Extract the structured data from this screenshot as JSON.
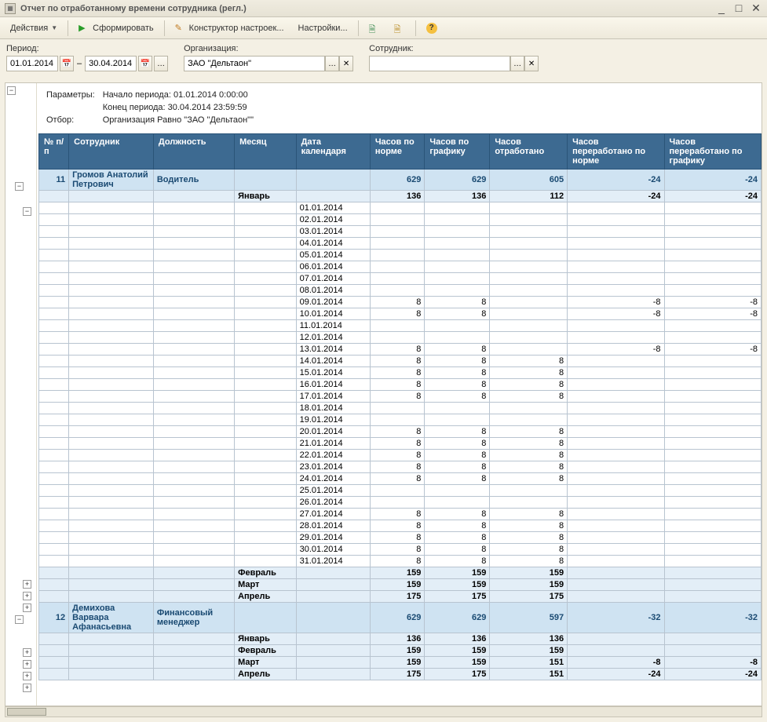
{
  "window": {
    "title": "Отчет по отработанному времени сотрудника (регл.)"
  },
  "toolbar": {
    "actions": "Действия",
    "form": "Сформировать",
    "ctor": "Конструктор настроек...",
    "settings": "Настройки..."
  },
  "filters": {
    "period_label": "Период:",
    "date_from": "01.01.2014",
    "date_to": "30.04.2014",
    "org_label": "Организация:",
    "org_value": "ЗАО \"Дельтаон\"",
    "emp_label": "Сотрудник:",
    "emp_value": ""
  },
  "params": {
    "params_label": "Параметры:",
    "line1": "Начало периода: 01.01.2014 0:00:00",
    "line2": "Конец периода: 30.04.2014 23:59:59",
    "filter_label": "Отбор:",
    "filter_text": "Организация Равно \"ЗАО \"Дельтаон\"\""
  },
  "headers": {
    "num": "№ п/п",
    "emp": "Сотрудник",
    "post": "Должность",
    "month": "Месяц",
    "date": "Дата календаря",
    "h1": "Часов по норме",
    "h2": "Часов по графику",
    "h3": "Часов отработано",
    "h4": "Часов переработано по норме",
    "h5": "Часов переработано по графику"
  },
  "rows": [
    {
      "t": "emp",
      "num": "11",
      "emp": "Громов Анатолий Петрович",
      "post": "Водитель",
      "h1": "629",
      "h2": "629",
      "h3": "605",
      "h4": "-24",
      "h5": "-24"
    },
    {
      "t": "month",
      "month": "Январь",
      "h1": "136",
      "h2": "136",
      "h3": "112",
      "h4": "-24",
      "h5": "-24"
    },
    {
      "t": "day",
      "date": "01.01.2014"
    },
    {
      "t": "day",
      "date": "02.01.2014"
    },
    {
      "t": "day",
      "date": "03.01.2014"
    },
    {
      "t": "day",
      "date": "04.01.2014"
    },
    {
      "t": "day",
      "date": "05.01.2014"
    },
    {
      "t": "day",
      "date": "06.01.2014"
    },
    {
      "t": "day",
      "date": "07.01.2014"
    },
    {
      "t": "day",
      "date": "08.01.2014"
    },
    {
      "t": "day",
      "date": "09.01.2014",
      "h1": "8",
      "h2": "8",
      "h4": "-8",
      "h5": "-8"
    },
    {
      "t": "day",
      "date": "10.01.2014",
      "h1": "8",
      "h2": "8",
      "h4": "-8",
      "h5": "-8"
    },
    {
      "t": "day",
      "date": "11.01.2014"
    },
    {
      "t": "day",
      "date": "12.01.2014"
    },
    {
      "t": "day",
      "date": "13.01.2014",
      "h1": "8",
      "h2": "8",
      "h4": "-8",
      "h5": "-8"
    },
    {
      "t": "day",
      "date": "14.01.2014",
      "h1": "8",
      "h2": "8",
      "h3": "8"
    },
    {
      "t": "day",
      "date": "15.01.2014",
      "h1": "8",
      "h2": "8",
      "h3": "8"
    },
    {
      "t": "day",
      "date": "16.01.2014",
      "h1": "8",
      "h2": "8",
      "h3": "8"
    },
    {
      "t": "day",
      "date": "17.01.2014",
      "h1": "8",
      "h2": "8",
      "h3": "8"
    },
    {
      "t": "day",
      "date": "18.01.2014"
    },
    {
      "t": "day",
      "date": "19.01.2014"
    },
    {
      "t": "day",
      "date": "20.01.2014",
      "h1": "8",
      "h2": "8",
      "h3": "8"
    },
    {
      "t": "day",
      "date": "21.01.2014",
      "h1": "8",
      "h2": "8",
      "h3": "8"
    },
    {
      "t": "day",
      "date": "22.01.2014",
      "h1": "8",
      "h2": "8",
      "h3": "8"
    },
    {
      "t": "day",
      "date": "23.01.2014",
      "h1": "8",
      "h2": "8",
      "h3": "8"
    },
    {
      "t": "day",
      "date": "24.01.2014",
      "h1": "8",
      "h2": "8",
      "h3": "8"
    },
    {
      "t": "day",
      "date": "25.01.2014"
    },
    {
      "t": "day",
      "date": "26.01.2014"
    },
    {
      "t": "day",
      "date": "27.01.2014",
      "h1": "8",
      "h2": "8",
      "h3": "8"
    },
    {
      "t": "day",
      "date": "28.01.2014",
      "h1": "8",
      "h2": "8",
      "h3": "8"
    },
    {
      "t": "day",
      "date": "29.01.2014",
      "h1": "8",
      "h2": "8",
      "h3": "8"
    },
    {
      "t": "day",
      "date": "30.01.2014",
      "h1": "8",
      "h2": "8",
      "h3": "8"
    },
    {
      "t": "day",
      "date": "31.01.2014",
      "h1": "8",
      "h2": "8",
      "h3": "8"
    },
    {
      "t": "month",
      "month": "Февраль",
      "h1": "159",
      "h2": "159",
      "h3": "159"
    },
    {
      "t": "month",
      "month": "Март",
      "h1": "159",
      "h2": "159",
      "h3": "159"
    },
    {
      "t": "month",
      "month": "Апрель",
      "h1": "175",
      "h2": "175",
      "h3": "175"
    },
    {
      "t": "emp",
      "num": "12",
      "emp": "Демихова Варвара Афанасьевна",
      "post": "Финансовый менеджер",
      "h1": "629",
      "h2": "629",
      "h3": "597",
      "h4": "-32",
      "h5": "-32"
    },
    {
      "t": "month",
      "month": "Январь",
      "h1": "136",
      "h2": "136",
      "h3": "136"
    },
    {
      "t": "month",
      "month": "Февраль",
      "h1": "159",
      "h2": "159",
      "h3": "159"
    },
    {
      "t": "month",
      "month": "Март",
      "h1": "159",
      "h2": "159",
      "h3": "151",
      "h4": "-8",
      "h5": "-8"
    },
    {
      "t": "month",
      "month": "Апрель",
      "h1": "175",
      "h2": "175",
      "h3": "151",
      "h4": "-24",
      "h5": "-24"
    }
  ]
}
